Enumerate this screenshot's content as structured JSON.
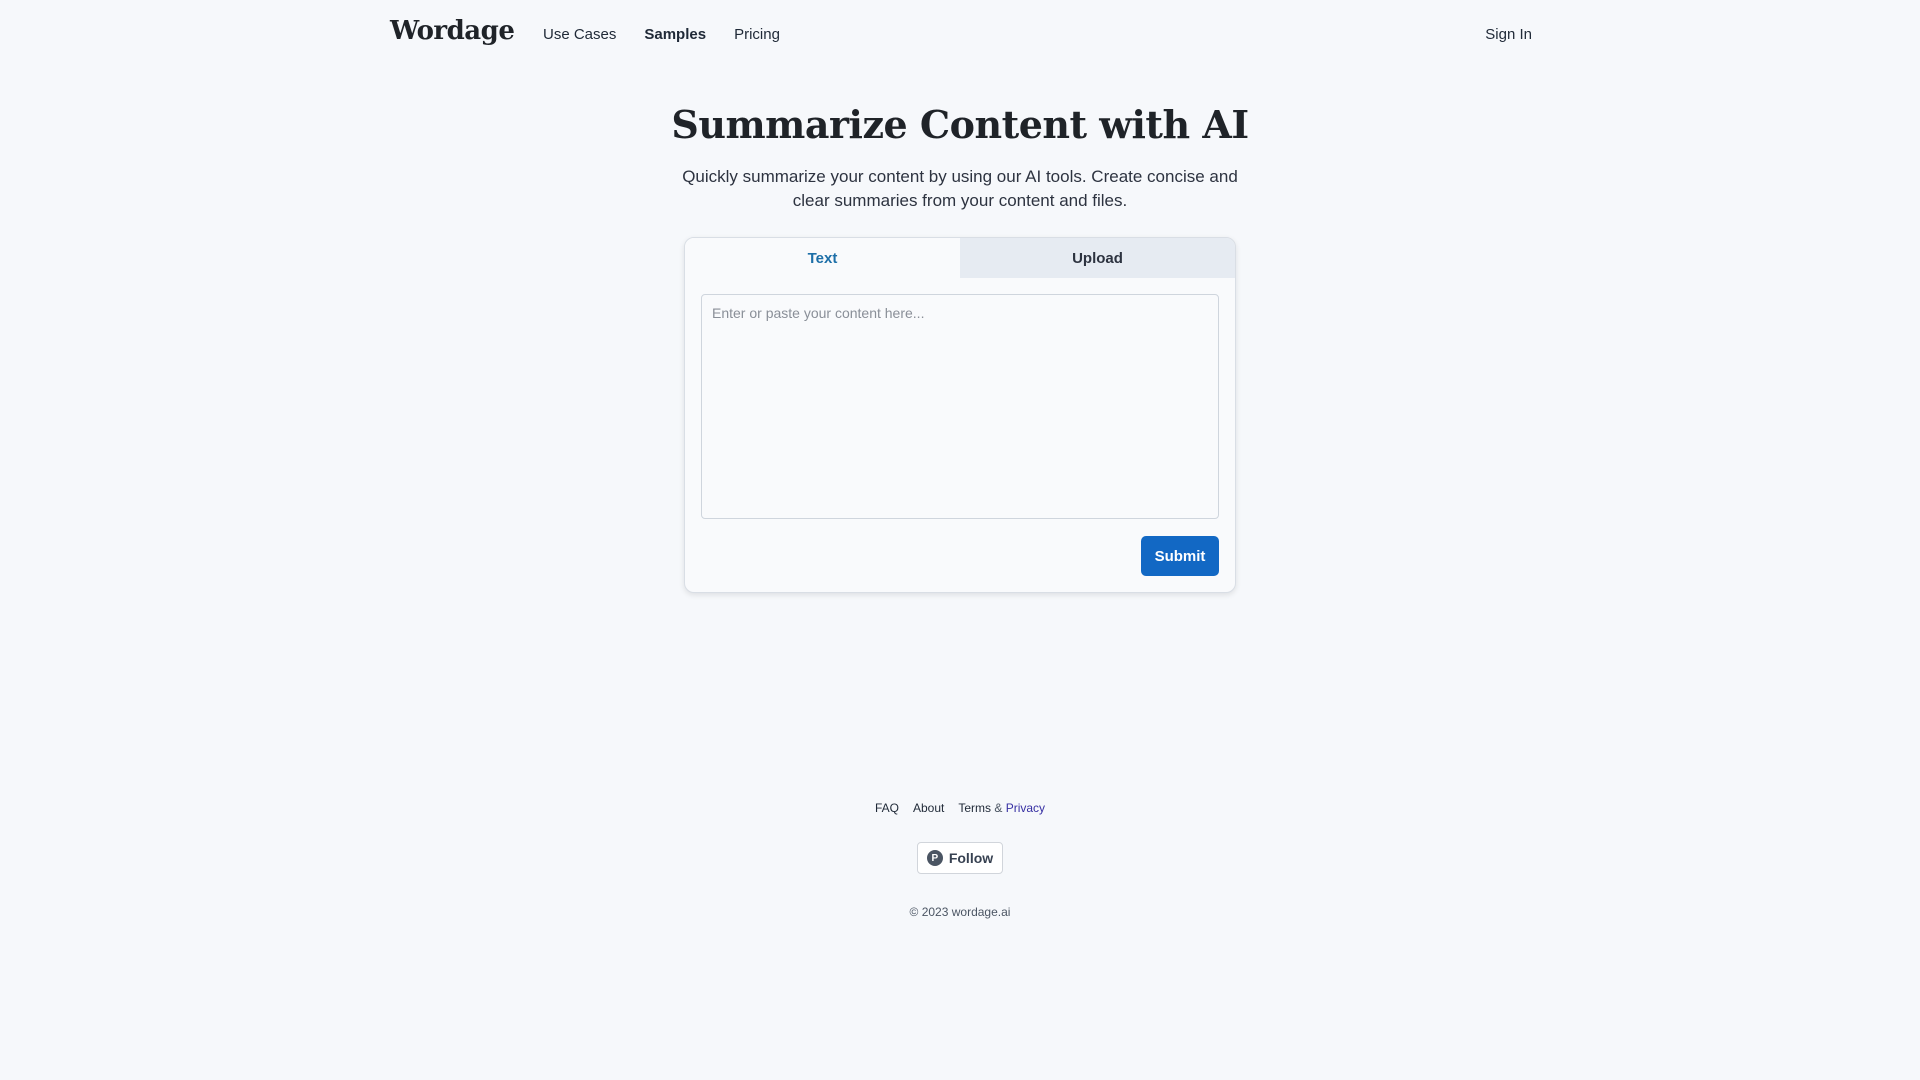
{
  "header": {
    "logo": "Wordage",
    "nav": [
      "Use Cases",
      "Samples",
      "Pricing"
    ],
    "sign_in": "Sign In"
  },
  "hero": {
    "title": "Summarize Content with AI",
    "subtitle": "Quickly summarize your content by using our AI tools. Create concise and clear summaries from your content and files."
  },
  "card": {
    "tabs": [
      {
        "label": "Text",
        "active": true
      },
      {
        "label": "Upload",
        "active": false
      }
    ],
    "textarea_placeholder": "Enter or paste your content here...",
    "textarea_value": "",
    "submit_label": "Submit"
  },
  "footer": {
    "links": {
      "faq": "FAQ",
      "about": "About",
      "terms": "Terms",
      "amp": "&",
      "privacy": "Privacy"
    },
    "follow_label": "Follow",
    "follow_icon_letter": "P",
    "copyright": "© 2023 wordage.ai"
  },
  "colors": {
    "background": "#f6f8fb",
    "accent": "#1268c4",
    "active_tab_text": "#1d6fa8",
    "privacy_link": "#3730a3"
  },
  "icons": {
    "follow": "product-hunt-icon"
  }
}
